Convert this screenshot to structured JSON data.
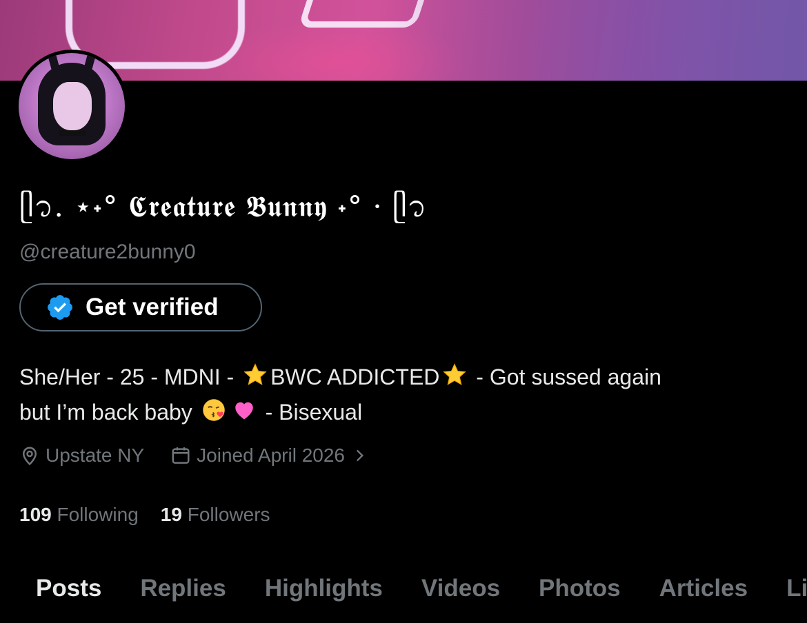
{
  "profile": {
    "display_name": "ᥫ᭡. ⋆˖° 𝕮𝖗𝖊𝖆𝖙𝖚𝖗𝖊 𝕭𝖚𝖓𝖓𝖞 ˖° · ᥫ᭡",
    "handle": "@creature2bunny0",
    "verify_label": "Get verified",
    "bio": {
      "line1_a": "She/Her - 25 - MDNI - ",
      "line1_b": "BWC ADDICTED",
      "line1_c": " - Got sussed again",
      "line2_a": "but I’m back baby",
      "line2_b": " - Bisexual"
    },
    "location": "Upstate NY",
    "joined": "Joined April 2026",
    "following_count": "109",
    "following_label": "Following",
    "followers_count": "19",
    "followers_label": "Followers"
  },
  "icons": {
    "verified": "verified-badge-icon",
    "location": "location-pin-icon",
    "calendar": "calendar-icon",
    "chevron": "chevron-right-icon",
    "star": "star-emoji",
    "kiss": "kissing-face-emoji",
    "heart": "pink-heart-emoji"
  },
  "colors": {
    "verified_blue": "#1d9bf0",
    "muted_text": "#71767b",
    "primary_text": "#e7e9ea",
    "background": "#000000"
  },
  "tabs": [
    {
      "label": "Posts",
      "active": true
    },
    {
      "label": "Replies",
      "active": false
    },
    {
      "label": "Highlights",
      "active": false
    },
    {
      "label": "Videos",
      "active": false
    },
    {
      "label": "Photos",
      "active": false
    },
    {
      "label": "Articles",
      "active": false
    },
    {
      "label": "Likes",
      "active": false
    }
  ]
}
